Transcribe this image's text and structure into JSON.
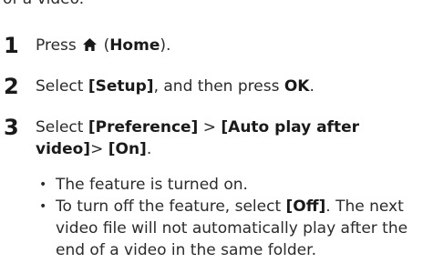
{
  "fragment": "of a video.",
  "steps": [
    {
      "number": "1",
      "text_before": "Press",
      "icon": "home-icon",
      "text_paren_open": "(",
      "bold": "Home",
      "text_after": ")."
    },
    {
      "number": "2",
      "text_before": "Select",
      "bold1": "[Setup]",
      "text_mid": ", and then press",
      "bold2": "OK",
      "text_after": "."
    },
    {
      "number": "3",
      "text_before": "Select",
      "bold1": "[Preference]",
      "sep1": " > ",
      "bold2": "[Auto play after",
      "bold2_cont": "video]",
      "sep2": "> ",
      "bold3": "[On]",
      "text_after": "."
    }
  ],
  "bullets": [
    {
      "text": "The feature is turned on."
    },
    {
      "text_before": "To turn off the feature, select",
      "bold": "[Off]",
      "text_after": ". The next video file will not automatically play after the end of a video in the same folder."
    }
  ]
}
